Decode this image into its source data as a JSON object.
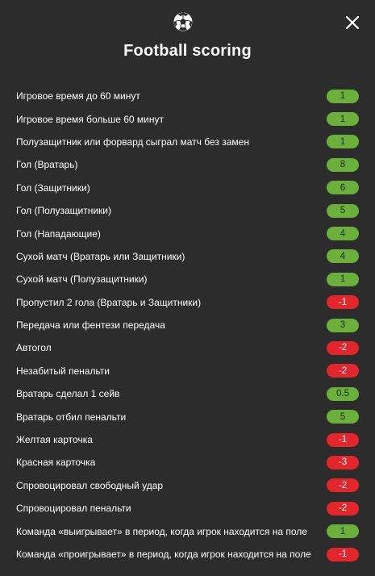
{
  "header": {
    "title": "Football scoring",
    "ball_icon": "soccer-ball-icon",
    "close_icon": "close-icon"
  },
  "colors": {
    "background": "#2c2c2c",
    "positive": "#6ab03b",
    "negative": "#e3262b"
  },
  "rules": [
    {
      "label": "Игровое время до 60 минут",
      "value": "1",
      "type": "pos"
    },
    {
      "label": "Игровое время больше 60 минут",
      "value": "1",
      "type": "pos"
    },
    {
      "label": "Полузащитник или форвард сыграл матч без замен",
      "value": "1",
      "type": "pos"
    },
    {
      "label": "Гол (Вратарь)",
      "value": "8",
      "type": "pos"
    },
    {
      "label": "Гол (Защитники)",
      "value": "6",
      "type": "pos"
    },
    {
      "label": "Гол (Полузащитники)",
      "value": "5",
      "type": "pos"
    },
    {
      "label": "Гол (Нападающие)",
      "value": "4",
      "type": "pos"
    },
    {
      "label": "Сухой матч (Вратарь или Защитники)",
      "value": "4",
      "type": "pos"
    },
    {
      "label": "Сухой матч (Полузащитники)",
      "value": "1",
      "type": "pos"
    },
    {
      "label": "Пропустил 2 гола (Вратарь и Защитники)",
      "value": "-1",
      "type": "neg"
    },
    {
      "label": "Передача или фентези передача",
      "value": "3",
      "type": "pos"
    },
    {
      "label": "Автогол",
      "value": "-2",
      "type": "neg"
    },
    {
      "label": "Незабитый пенальти",
      "value": "-2",
      "type": "neg"
    },
    {
      "label": "Вратарь сделал 1 сейв",
      "value": "0.5",
      "type": "pos"
    },
    {
      "label": "Вратарь отбил пенальти",
      "value": "5",
      "type": "pos"
    },
    {
      "label": "Желтая карточка",
      "value": "-1",
      "type": "neg"
    },
    {
      "label": "Красная карточка",
      "value": "-3",
      "type": "neg"
    },
    {
      "label": "Спровоцировал свободный удар",
      "value": "-2",
      "type": "neg"
    },
    {
      "label": "Спровоцировал пенальти",
      "value": "-2",
      "type": "neg"
    },
    {
      "label": "Команда «выигрывает» в период, когда игрок находится на поле",
      "value": "1",
      "type": "pos"
    },
    {
      "label": "Команда «проигрывает» в период, когда игрок находится на поле",
      "value": "-1",
      "type": "neg"
    }
  ]
}
